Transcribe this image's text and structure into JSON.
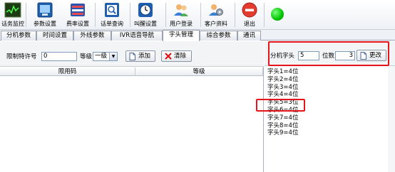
{
  "toolbar": {
    "buttons": [
      {
        "label": "话务监控",
        "icon": "monitor-chart-icon"
      },
      {
        "label": "参数设置",
        "icon": "settings-screen-icon"
      },
      {
        "label": "费率设置",
        "icon": "rate-card-icon"
      },
      {
        "label": "话单查询",
        "icon": "bill-search-icon"
      },
      {
        "label": "叫醒设置",
        "icon": "alarm-clock-icon"
      },
      {
        "label": "用户登录",
        "icon": "users-icon"
      },
      {
        "label": "客户资料",
        "icon": "customer-gear-icon"
      },
      {
        "label": "退出",
        "icon": "exit-icon"
      }
    ],
    "status_color": "#00c400"
  },
  "tabs": [
    {
      "label": "分机参数"
    },
    {
      "label": "时间设置"
    },
    {
      "label": "外线参数"
    },
    {
      "label": "IVR语音导航"
    },
    {
      "label": "字头管理",
      "active": true
    },
    {
      "label": "综合参数"
    },
    {
      "label": "通讯"
    }
  ],
  "restrict": {
    "permit_label": "限制特许号",
    "permit_value": "0",
    "level_label": "等级",
    "level_value": "一级",
    "add_label": "添加",
    "clear_label": "清除"
  },
  "table": {
    "columns": [
      "限用码",
      "等级"
    ],
    "rows": []
  },
  "prefix": {
    "ext_prefix_label": "分机字头",
    "ext_prefix_value": "5",
    "digits_label": "位数",
    "digits_value": "3",
    "change_label": "更改",
    "items": [
      "字头1=4位",
      "字头2=4位",
      "字头3=4位",
      "字头4=4位",
      "字头5=3位",
      "字头6=4位",
      "字头7=4位",
      "字头8=4位",
      "字头9=4位"
    ]
  },
  "colors": {
    "highlight": "#e8141b",
    "accent": "#2b5797"
  }
}
